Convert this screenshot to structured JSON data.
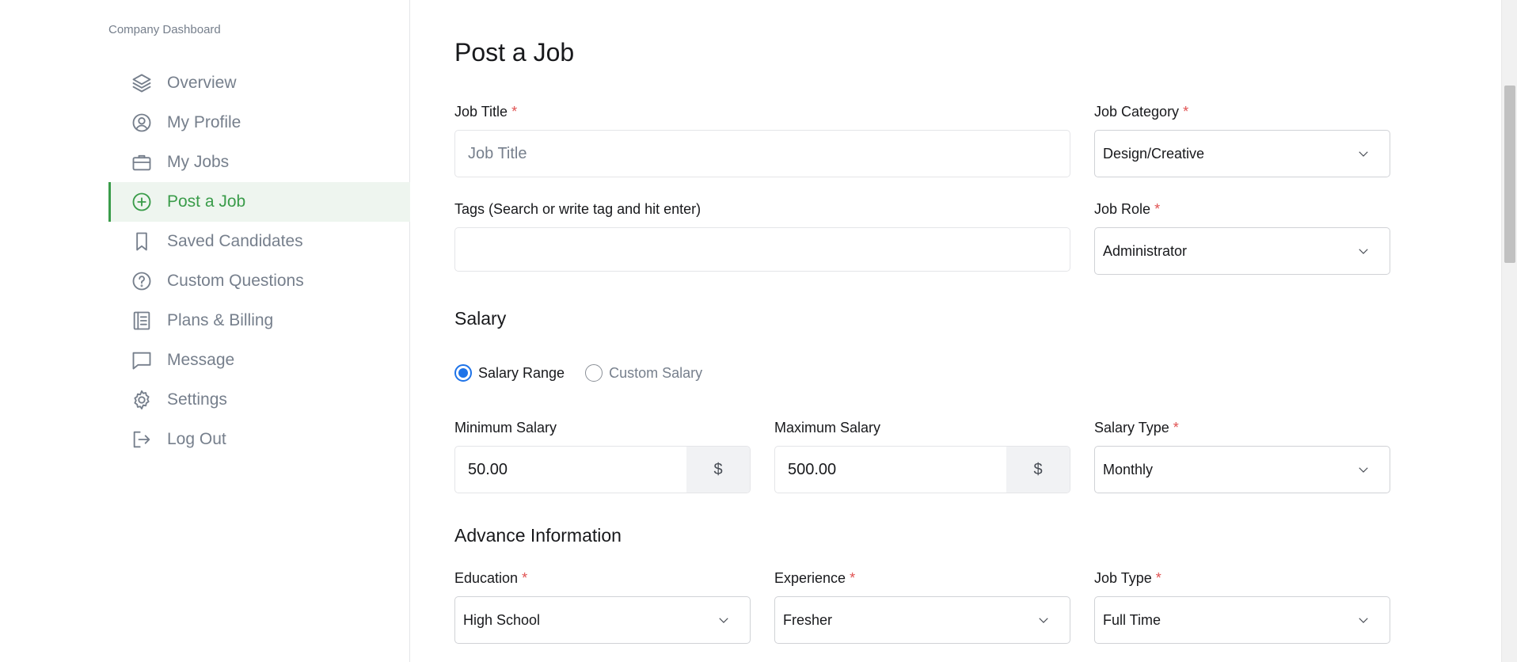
{
  "sidebar": {
    "caption": "Company Dashboard",
    "items": [
      {
        "label": "Overview",
        "icon": "layers-icon",
        "active": false
      },
      {
        "label": "My Profile",
        "icon": "user-circle-icon",
        "active": false
      },
      {
        "label": "My Jobs",
        "icon": "briefcase-icon",
        "active": false
      },
      {
        "label": "Post a Job",
        "icon": "plus-circle-icon",
        "active": true
      },
      {
        "label": "Saved Candidates",
        "icon": "bookmark-icon",
        "active": false
      },
      {
        "label": "Custom Questions",
        "icon": "question-circle-icon",
        "active": false
      },
      {
        "label": "Plans & Billing",
        "icon": "notebook-icon",
        "active": false
      },
      {
        "label": "Message",
        "icon": "chat-icon",
        "active": false
      },
      {
        "label": "Settings",
        "icon": "gear-icon",
        "active": false
      },
      {
        "label": "Log Out",
        "icon": "logout-icon",
        "active": false
      }
    ]
  },
  "main": {
    "title": "Post a Job",
    "job_title": {
      "label": "Job Title",
      "required_mark": "*",
      "placeholder": "Job Title",
      "value": ""
    },
    "job_category": {
      "label": "Job Category",
      "required_mark": "*",
      "value": "Design/Creative"
    },
    "tags": {
      "label": "Tags (Search or write tag and hit enter)",
      "value": ""
    },
    "job_role": {
      "label": "Job Role",
      "required_mark": "*",
      "value": "Administrator"
    },
    "salary": {
      "title": "Salary",
      "options": [
        {
          "label": "Salary Range",
          "checked": true
        },
        {
          "label": "Custom Salary",
          "checked": false
        }
      ],
      "min": {
        "label": "Minimum Salary",
        "value": "50.00",
        "currency": "$"
      },
      "max": {
        "label": "Maximum Salary",
        "value": "500.00",
        "currency": "$"
      },
      "type": {
        "label": "Salary Type",
        "required_mark": "*",
        "value": "Monthly"
      }
    },
    "advance": {
      "title": "Advance Information",
      "education": {
        "label": "Education",
        "required_mark": "*",
        "value": "High School"
      },
      "experience": {
        "label": "Experience",
        "required_mark": "*",
        "value": "Fresher"
      },
      "job_type": {
        "label": "Job Type",
        "required_mark": "*",
        "value": "Full Time"
      }
    }
  },
  "colors": {
    "accent": "#3a9c4a",
    "radio": "#1e73e8",
    "required": "#e05151"
  }
}
